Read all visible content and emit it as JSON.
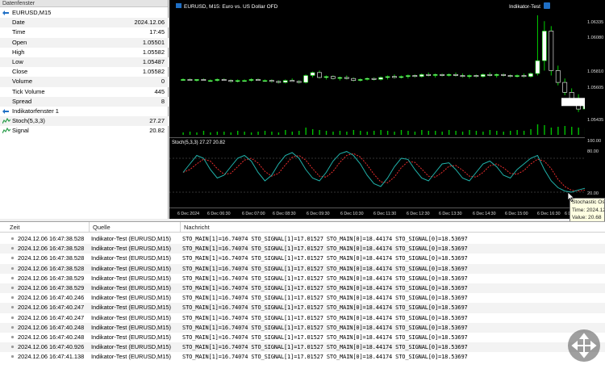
{
  "data_window": {
    "title": "Datenfenster",
    "symbol": "EURUSD,M15",
    "rows": [
      {
        "label": "Date",
        "value": "2024.12.06"
      },
      {
        "label": "Time",
        "value": "17:45"
      },
      {
        "label": "Open",
        "value": "1.05501"
      },
      {
        "label": "High",
        "value": "1.05582"
      },
      {
        "label": "Low",
        "value": "1.05487"
      },
      {
        "label": "Close",
        "value": "1.05582"
      },
      {
        "label": "Volume",
        "value": "0"
      },
      {
        "label": "Tick Volume",
        "value": "445"
      },
      {
        "label": "Spread",
        "value": "8"
      }
    ],
    "indicator_window": "Indikatorfenster 1",
    "indicator_rows": [
      {
        "label": "Stoch(5,3,3)",
        "value": "27.27"
      },
      {
        "label": "Signal",
        "value": "20.82"
      }
    ]
  },
  "chart": {
    "title": "EURUSD, M15: Euro vs. US Dollar OFD",
    "expert_label": "Indikator-Test",
    "stoch_label": "Stoch(5,3,3) 27.27 20.82",
    "price_axis": [
      "1.06335",
      "1.06080",
      "1.05810",
      "1.05605",
      "1.05582",
      "1.05435"
    ],
    "stoch_axis": [
      "100.00",
      "80.00",
      "20.00",
      "0.00"
    ],
    "time_axis": [
      "6 Dec 2024",
      "6 Dec 06:30",
      "6 Dec 07:00",
      "6 Dec 08:30",
      "6 Dec 09:30",
      "6 Dec 10:30",
      "6 Dec 11:30",
      "6 Dec 12:30",
      "6 Dec 13:30",
      "6 Dec 14:30",
      "6 Dec 15:00",
      "6 Dec 16:30",
      "6 Dec 17:30"
    ]
  },
  "tooltip": {
    "lines": [
      "Stochastic Oscillator",
      "Time: 2024.12.06 17:45",
      "Value: 20.68"
    ]
  },
  "log": {
    "columns": [
      "Zeit",
      "Quelle",
      "Nachricht"
    ],
    "rows": [
      {
        "time": "2024.12.06 16:47:38.528",
        "source": "Indikator-Test (EURUSD,M15)",
        "message": "STO_MAIN[1]=16.74074 STO_SIGNAL[1]=17.01527 STO_MAIN[0]=18.44174 STO_SIGNAL[0]=18.53697"
      },
      {
        "time": "2024.12.06 16:47:38.528",
        "source": "Indikator-Test (EURUSD,M15)",
        "message": "STO_MAIN[1]=16.74074 STO_SIGNAL[1]=17.01527 STO_MAIN[0]=18.44174 STO_SIGNAL[0]=18.53697"
      },
      {
        "time": "2024.12.06 16:47:38.528",
        "source": "Indikator-Test (EURUSD,M15)",
        "message": "STO_MAIN[1]=16.74074 STO_SIGNAL[1]=17.01527 STO_MAIN[0]=18.44174 STO_SIGNAL[0]=18.53697"
      },
      {
        "time": "2024.12.06 16:47:38.528",
        "source": "Indikator-Test (EURUSD,M15)",
        "message": "STO_MAIN[1]=16.74074 STO_SIGNAL[1]=17.01527 STO_MAIN[0]=18.44174 STO_SIGNAL[0]=18.53697"
      },
      {
        "time": "2024.12.06 16:47:38.529",
        "source": "Indikator-Test (EURUSD,M15)",
        "message": "STO_MAIN[1]=16.74074 STO_SIGNAL[1]=17.01527 STO_MAIN[0]=18.44174 STO_SIGNAL[0]=18.53697"
      },
      {
        "time": "2024.12.06 16:47:38.529",
        "source": "Indikator-Test (EURUSD,M15)",
        "message": "STO_MAIN[1]=16.74074 STO_SIGNAL[1]=17.01527 STO_MAIN[0]=18.44174 STO_SIGNAL[0]=18.53697"
      },
      {
        "time": "2024.12.06 16:47:40.246",
        "source": "Indikator-Test (EURUSD,M15)",
        "message": "STO_MAIN[1]=16.74074 STO_SIGNAL[1]=17.01527 STO_MAIN[0]=18.44174 STO_SIGNAL[0]=18.53697"
      },
      {
        "time": "2024.12.06 16:47:40.247",
        "source": "Indikator-Test (EURUSD,M15)",
        "message": "STO_MAIN[1]=16.74074 STO_SIGNAL[1]=17.01527 STO_MAIN[0]=18.44174 STO_SIGNAL[0]=18.53697"
      },
      {
        "time": "2024.12.06 16:47:40.247",
        "source": "Indikator-Test (EURUSD,M15)",
        "message": "STO_MAIN[1]=16.74074 STO_SIGNAL[1]=17.01527 STO_MAIN[0]=18.44174 STO_SIGNAL[0]=18.53697"
      },
      {
        "time": "2024.12.06 16:47:40.248",
        "source": "Indikator-Test (EURUSD,M15)",
        "message": "STO_MAIN[1]=16.74074 STO_SIGNAL[1]=17.01527 STO_MAIN[0]=18.44174 STO_SIGNAL[0]=18.53697"
      },
      {
        "time": "2024.12.06 16:47:40.248",
        "source": "Indikator-Test (EURUSD,M15)",
        "message": "STO_MAIN[1]=16.74074 STO_SIGNAL[1]=17.01527 STO_MAIN[0]=18.44174 STO_SIGNAL[0]=18.53697"
      },
      {
        "time": "2024.12.06 16:47:40.926",
        "source": "Indikator-Test (EURUSD,M15)",
        "message": "STO_MAIN[1]=16.74074 STO_SIGNAL[1]=17.01527 STO_MAIN[0]=18.44174 STO_SIGNAL[0]=18.53697"
      },
      {
        "time": "2024.12.06 16:47:41.138",
        "source": "Indikator-Test (EURUSD,M15)",
        "message": "STO_MAIN[1]=16.74074 STO_SIGNAL[1]=17.01527 STO_MAIN[0]=18.44174 STO_SIGNAL[0]=18.53697"
      }
    ]
  },
  "colors": {
    "chart_bg": "#000000",
    "bull_candle": "#ffffff",
    "bear_candle": "#ffffff",
    "candle_outline": "#00d000",
    "volume": "#00c000",
    "stoch_main": "#20b2aa",
    "stoch_signal": "#ff3030"
  },
  "icons": {
    "symbol": "currency-pair-icon",
    "indicator": "stochastic-icon",
    "log_entry": "info-dot-icon",
    "move": "move-arrows-icon"
  }
}
